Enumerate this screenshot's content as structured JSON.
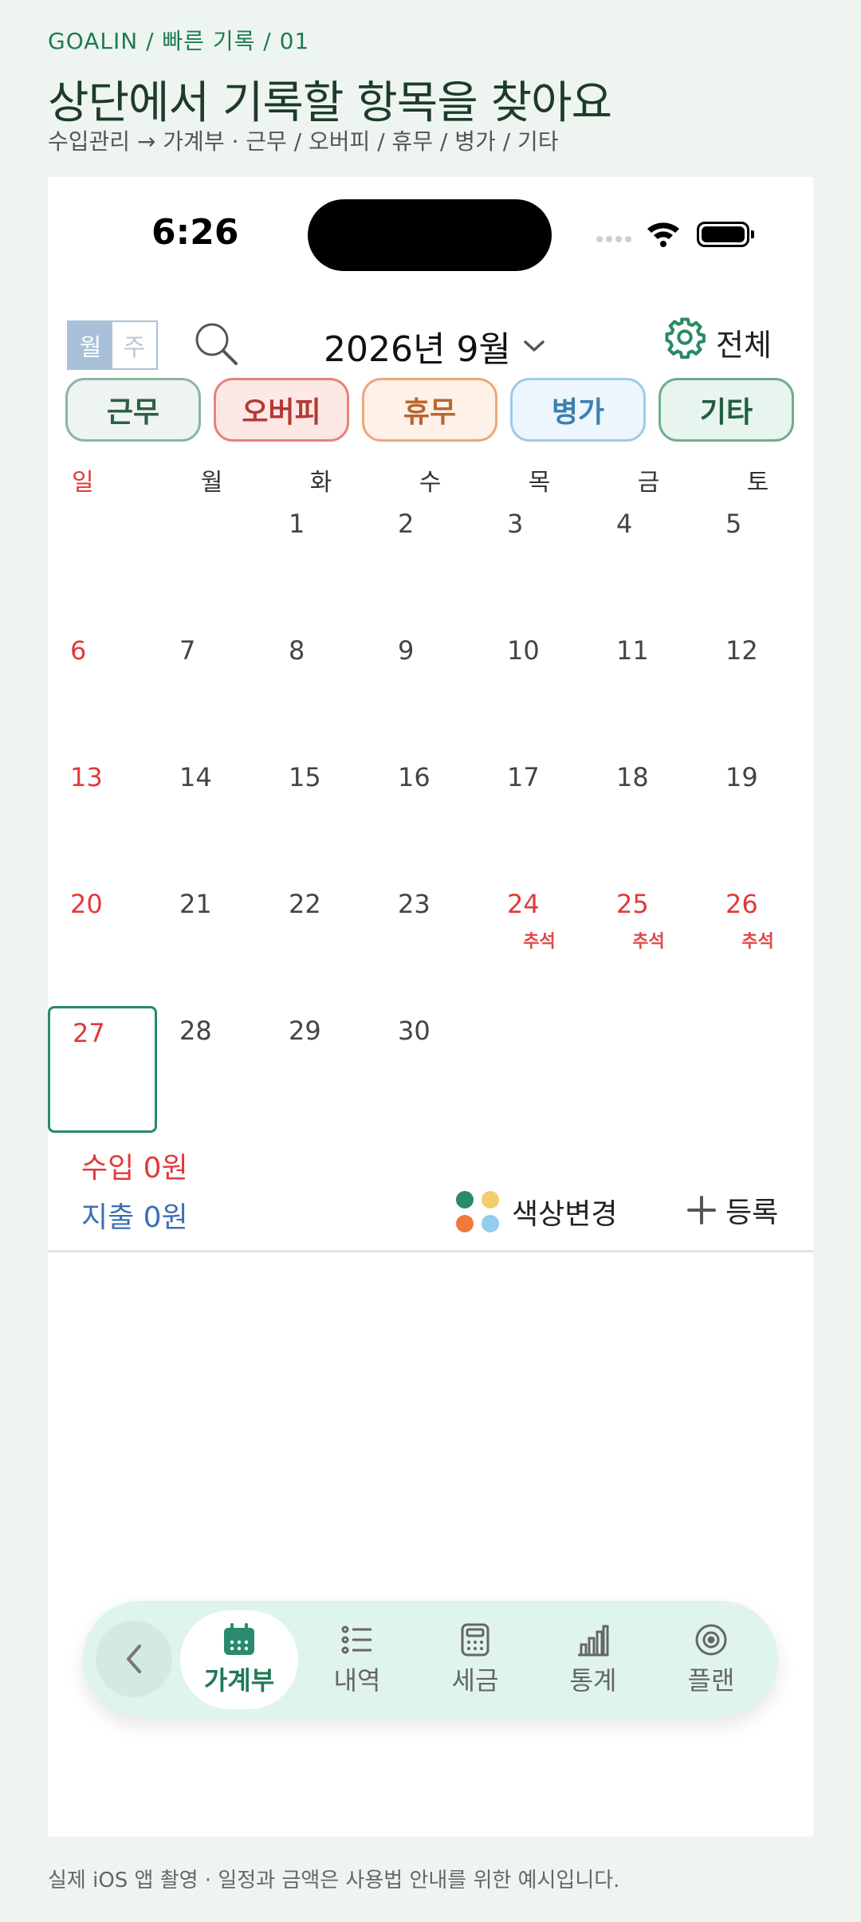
{
  "header": {
    "breadcrumb": "GOALIN  /  빠른 기록  /  01",
    "title": "상단에서 기록할 항목을 찾아요",
    "subtitle": "수입관리 → 가계부 · 근무 / 오버피 / 휴무 / 병가 / 기타"
  },
  "status_bar": {
    "time": "6:26"
  },
  "toolbar": {
    "view_month": "월",
    "view_week": "주",
    "month_label": "2026년 9월",
    "all_label": "전체"
  },
  "chips": [
    {
      "label": "근무",
      "bg": "#eef4f1",
      "border": "#8fb5a2",
      "text": "#2f5e48"
    },
    {
      "label": "오버피",
      "bg": "#fde8e6",
      "border": "#e5837a",
      "text": "#b33a33"
    },
    {
      "label": "휴무",
      "bg": "#fdf1e8",
      "border": "#eba87b",
      "text": "#b9662f"
    },
    {
      "label": "병가",
      "bg": "#edf6fc",
      "border": "#9ecbe8",
      "text": "#3f7fae"
    },
    {
      "label": "기타",
      "bg": "#e8f4ee",
      "border": "#6fae8d",
      "text": "#1f5e3f"
    }
  ],
  "weekdays": [
    "일",
    "월",
    "화",
    "수",
    "목",
    "금",
    "토"
  ],
  "calendar": {
    "days": [
      {
        "d": "1",
        "col": 2,
        "row": 0
      },
      {
        "d": "2",
        "col": 3,
        "row": 0
      },
      {
        "d": "3",
        "col": 4,
        "row": 0
      },
      {
        "d": "4",
        "col": 5,
        "row": 0
      },
      {
        "d": "5",
        "col": 6,
        "row": 0
      },
      {
        "d": "6",
        "col": 0,
        "row": 1,
        "red": true
      },
      {
        "d": "7",
        "col": 1,
        "row": 1
      },
      {
        "d": "8",
        "col": 2,
        "row": 1
      },
      {
        "d": "9",
        "col": 3,
        "row": 1
      },
      {
        "d": "10",
        "col": 4,
        "row": 1
      },
      {
        "d": "11",
        "col": 5,
        "row": 1
      },
      {
        "d": "12",
        "col": 6,
        "row": 1
      },
      {
        "d": "13",
        "col": 0,
        "row": 2,
        "red": true
      },
      {
        "d": "14",
        "col": 1,
        "row": 2
      },
      {
        "d": "15",
        "col": 2,
        "row": 2
      },
      {
        "d": "16",
        "col": 3,
        "row": 2
      },
      {
        "d": "17",
        "col": 4,
        "row": 2
      },
      {
        "d": "18",
        "col": 5,
        "row": 2
      },
      {
        "d": "19",
        "col": 6,
        "row": 2
      },
      {
        "d": "20",
        "col": 0,
        "row": 3,
        "red": true
      },
      {
        "d": "21",
        "col": 1,
        "row": 3
      },
      {
        "d": "22",
        "col": 2,
        "row": 3
      },
      {
        "d": "23",
        "col": 3,
        "row": 3
      },
      {
        "d": "24",
        "col": 4,
        "row": 3,
        "red": true,
        "holiday": "추석"
      },
      {
        "d": "25",
        "col": 5,
        "row": 3,
        "red": true,
        "holiday": "추석"
      },
      {
        "d": "26",
        "col": 6,
        "row": 3,
        "red": true,
        "holiday": "추석"
      },
      {
        "d": "27",
        "col": 0,
        "row": 4,
        "red": true,
        "today": true
      },
      {
        "d": "28",
        "col": 1,
        "row": 4
      },
      {
        "d": "29",
        "col": 2,
        "row": 4
      },
      {
        "d": "30",
        "col": 3,
        "row": 4
      }
    ]
  },
  "summary": {
    "income": "수입 0원",
    "expense": "지출 0원",
    "color_change": "색상변경",
    "register": "등록"
  },
  "nav": {
    "tabs": [
      {
        "label": "가계부",
        "icon": "calendar-icon",
        "active": true
      },
      {
        "label": "내역",
        "icon": "list-icon"
      },
      {
        "label": "세금",
        "icon": "calculator-icon"
      },
      {
        "label": "통계",
        "icon": "bar-chart-icon"
      },
      {
        "label": "플랜",
        "icon": "target-icon"
      }
    ]
  },
  "footer": "실제 iOS 앱 촬영 · 일정과 금액은 사용법 안내를 위한 예시입니다.",
  "colors": {
    "accent": "#1f7a55",
    "income": "#e03a3a",
    "expense": "#3c6fb8",
    "holiday": "#e04848"
  }
}
